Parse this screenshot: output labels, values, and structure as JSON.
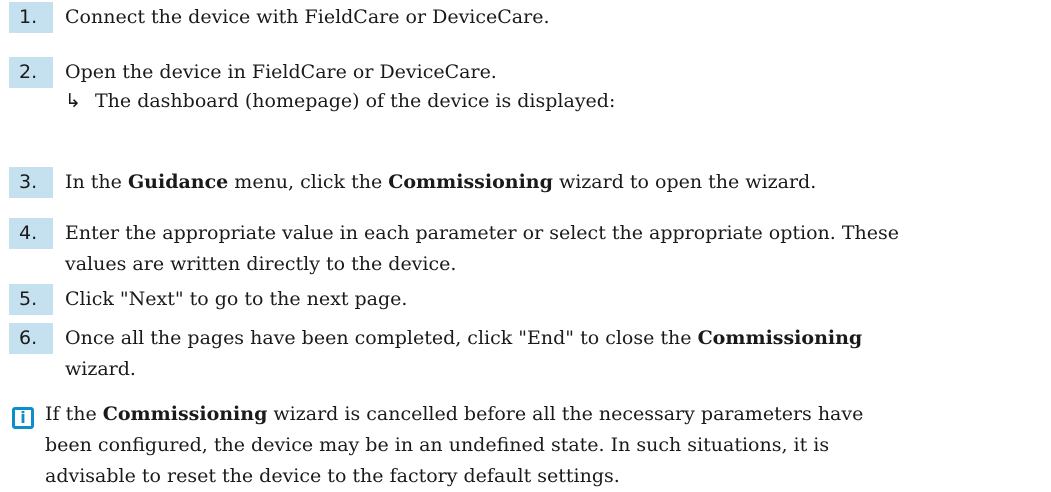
{
  "steps": [
    {
      "number": "1.",
      "lines": [
        [
          {
            "t": "Connect the device with FieldCare or DeviceCare."
          }
        ]
      ]
    },
    {
      "number": "2.",
      "lines": [
        [
          {
            "t": "Open the device in FieldCare or DeviceCare."
          }
        ]
      ],
      "result": {
        "arrow": "↳",
        "text": "The dashboard (homepage) of the device is displayed:"
      }
    },
    {
      "number": "3.",
      "lines": [
        [
          {
            "t": "In the "
          },
          {
            "t": "Guidance",
            "b": true
          },
          {
            "t": " menu, click the "
          },
          {
            "t": "Commissioning",
            "b": true
          },
          {
            "t": " wizard to open the wizard."
          }
        ]
      ]
    },
    {
      "number": "4.",
      "lines": [
        [
          {
            "t": "Enter the appropriate value in each parameter or select the appropriate option. These"
          }
        ],
        [
          {
            "t": "values are written directly to the device."
          }
        ]
      ]
    },
    {
      "number": "5.",
      "lines": [
        [
          {
            "t": "Click \"Next\" to go to the next page."
          }
        ]
      ]
    },
    {
      "number": "6.",
      "lines": [
        [
          {
            "t": "Once all the pages have been completed, click \"End\" to close the "
          },
          {
            "t": "Commissioning",
            "b": true
          }
        ],
        [
          {
            "t": "wizard."
          }
        ]
      ]
    }
  ],
  "note": {
    "icon": "info-icon",
    "icon_glyph": "i",
    "icon_color": "#0a8fc8",
    "lines": [
      [
        {
          "t": "If the "
        },
        {
          "t": "Commissioning",
          "b": true
        },
        {
          "t": " wizard is cancelled before all the necessary parameters have"
        }
      ],
      [
        {
          "t": "been configured, the device may be in an undefined state. In such situations, it is"
        }
      ],
      [
        {
          "t": "advisable to reset the device to the factory default settings."
        }
      ]
    ]
  },
  "colors": {
    "step_number_bg": "#c5e0ef",
    "text": "#1a1a1a"
  }
}
